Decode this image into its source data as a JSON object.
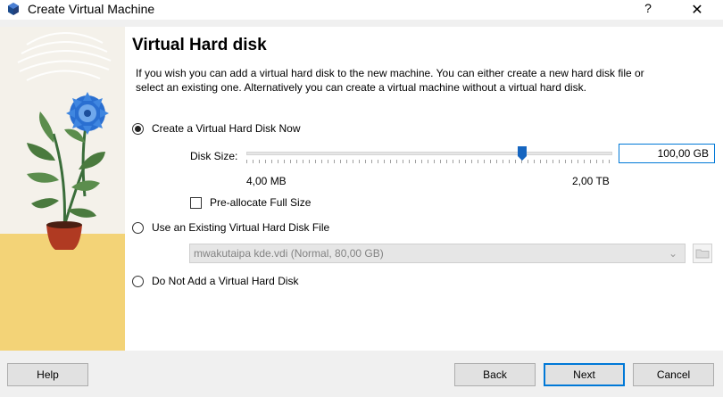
{
  "window": {
    "title": "Create Virtual Machine",
    "help_label": "?",
    "close_label": "✕"
  },
  "page": {
    "heading": "Virtual Hard disk",
    "description": "If you wish you can add a virtual hard disk to the new machine. You can either create a new hard disk file or select an existing one. Alternatively you can create a virtual machine without a virtual hard disk."
  },
  "options": {
    "create_now": "Create a Virtual Hard Disk Now",
    "use_existing": "Use an Existing Virtual Hard Disk File",
    "no_disk": "Do Not Add a Virtual Hard Disk",
    "selected": "create_now"
  },
  "disk_size": {
    "label": "Disk Size:",
    "value": "100,00 GB",
    "min_label": "4,00 MB",
    "max_label": "2,00 TB",
    "preallocate_label": "Pre-allocate Full Size",
    "preallocate_checked": false
  },
  "existing_file": {
    "selected": "mwakutaipa kde.vdi (Normal, 80,00 GB)",
    "enabled": false
  },
  "buttons": {
    "help": "Help",
    "back": "Back",
    "next": "Next",
    "cancel": "Cancel"
  },
  "colors": {
    "accent": "#0078d7",
    "thumb": "#1565c0",
    "sand": "#f3d377"
  },
  "icons": {
    "app": "virtualbox-icon",
    "folder": "folder-icon",
    "chevron": "chevron-down-icon"
  }
}
